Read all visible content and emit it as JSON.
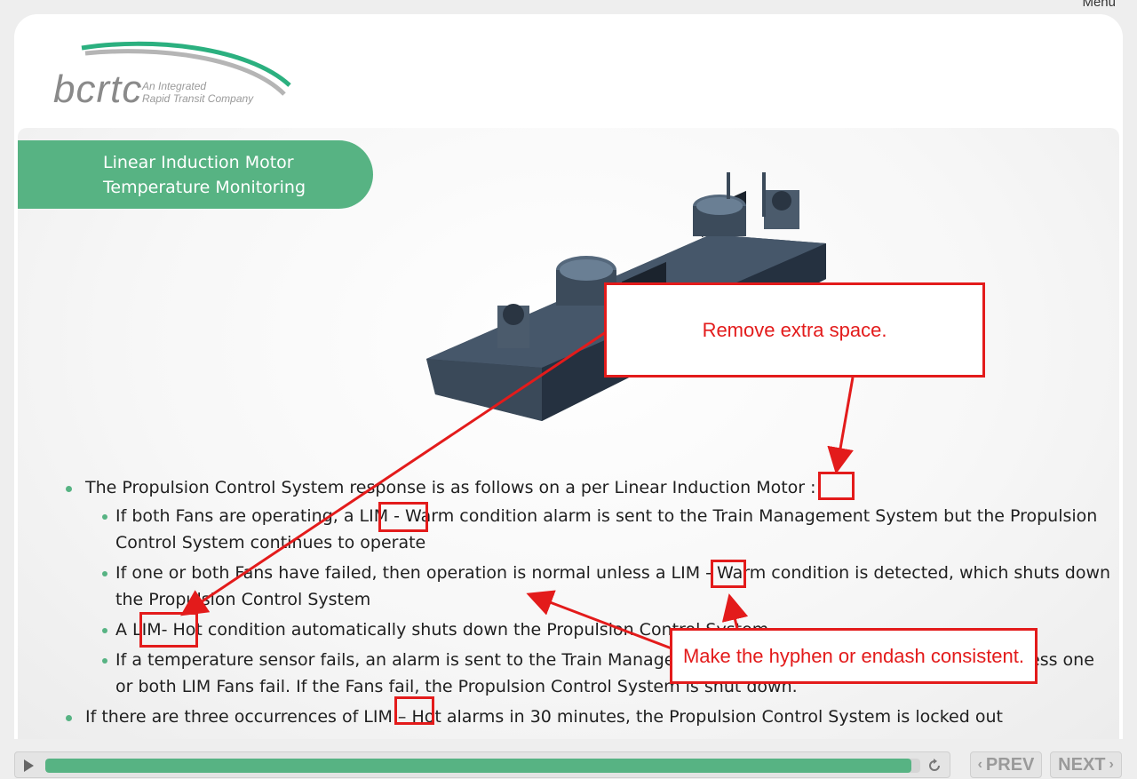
{
  "menu": {
    "label": "Menu"
  },
  "logo": {
    "wordmark": "bcrtc",
    "tagline_1": "An Integrated",
    "tagline_2": "Rapid Transit Company"
  },
  "slide": {
    "title_line_1": "Linear Induction Motor",
    "title_line_2": "Temperature Monitoring",
    "bullets": [
      {
        "text": "The Propulsion Control System response is as follows on a per Linear Induction Motor :",
        "sub": [
          "If both Fans are operating, a LIM - Warm condition alarm is sent to the Train Management System but the Propulsion Control System continues to operate",
          "If one or both Fans have failed, then operation is normal unless a LIM - Warm condition is detected, which shuts down the Propulsion Control System",
          "A LIM- Hot condition automatically shuts down the Propulsion Control System",
          "If a temperature sensor fails, an alarm is sent to the Train Management System and operation continues unless one or both LIM Fans fail. If the Fans fail, the Propulsion Control System is shut down."
        ]
      },
      {
        "text": "If there are three occurrences of LIM – Hot alarms in 30 minutes, the Propulsion Control System is locked out",
        "sub": []
      }
    ]
  },
  "annotations": {
    "space_note": "Remove extra space.",
    "hyphen_note": "Make the hyphen or endash consistent.",
    "color": "#e31b1b"
  },
  "player": {
    "progress_percent": 99,
    "prev_label": "PREV",
    "next_label": "NEXT"
  },
  "colors": {
    "accent": "#57b383",
    "annotation": "#e31b1b"
  }
}
